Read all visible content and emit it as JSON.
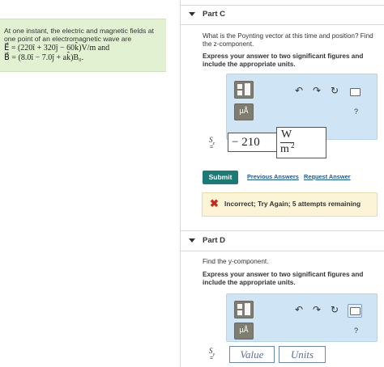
{
  "problem": {
    "line1": "At one instant, the electric and magnetic fields at",
    "line2": "one point of an electromagnetic wave are",
    "e_field": "E⃗ = (220î + 320ĵ − 60k̂)V/m and",
    "b_field": "B⃗ = (8.0î − 7.0ĵ + ak̂)B₀."
  },
  "part_c": {
    "title": "Part C",
    "question_line1": "What is the Poynting vector at this time and position? Find",
    "question_line2": "the z-component.",
    "instruction_line1": "Express your answer to two significant figures and",
    "instruction_line2": "include the appropriate units.",
    "toolbar": {
      "units_btn": "μÅ",
      "help": "?"
    },
    "variable": "S",
    "subscript": "z",
    "equals": "=",
    "value": "− 210",
    "unit_numerator": "W",
    "unit_denominator": "m",
    "unit_exponent": "2",
    "submit": "Submit",
    "previous_answers": "Previous Answers",
    "request_answer": "Request Answer",
    "feedback": "Incorrect; Try Again; 5 attempts remaining"
  },
  "part_d": {
    "title": "Part D",
    "question": "Find the y-component.",
    "instruction_line1": "Express your answer to two significant figures and",
    "instruction_line2": "include the appropriate units.",
    "toolbar": {
      "units_btn": "μÅ",
      "help": "?"
    },
    "variable": "S",
    "subscript": "y",
    "equals": "=",
    "value_placeholder": "Value",
    "units_placeholder": "Units"
  },
  "colors": {
    "problem_bg": "#e3f1d3",
    "widget_bg": "#cfe5f6",
    "submit_bg": "#197a76",
    "feedback_bg": "#fbf4d6",
    "error_red": "#d0231b",
    "link": "#1a5a9a"
  },
  "icons": [
    "templates-icon",
    "units-icon",
    "undo-icon",
    "redo-icon",
    "reset-icon",
    "keyboard-icon",
    "help-icon",
    "error-x-icon",
    "collapse-caret-icon"
  ]
}
